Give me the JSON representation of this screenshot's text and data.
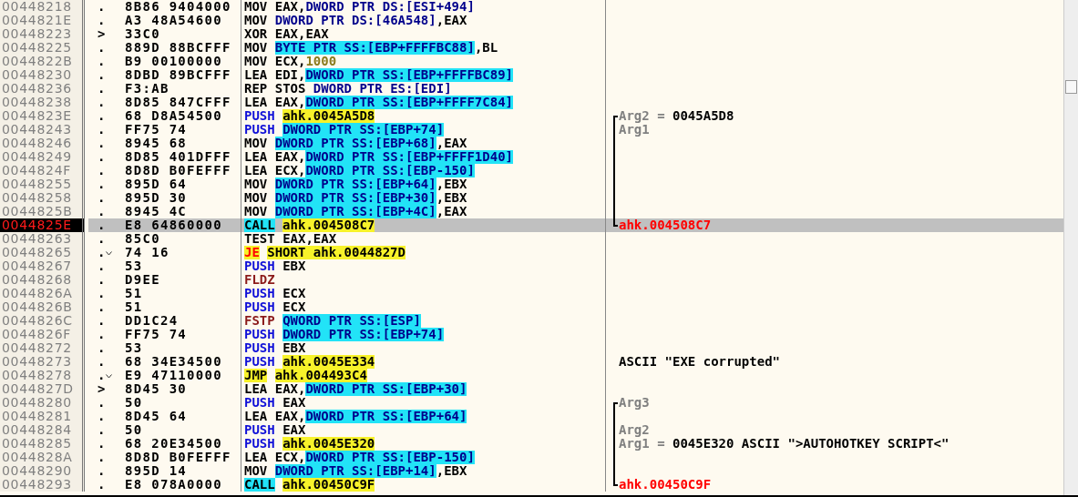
{
  "rows": [
    {
      "address": "00448218",
      "marker": ".",
      "jump": false,
      "selected": false,
      "hex": "8B86 9404000",
      "code": [
        {
          "kind": "plain",
          "text": "MOV EAX,"
        },
        {
          "kind": "ptr",
          "text": "DWORD PTR DS:[ESI+494]"
        }
      ]
    },
    {
      "address": "0044821E",
      "marker": ".",
      "jump": false,
      "selected": false,
      "hex": "A3 48A54600",
      "code": [
        {
          "kind": "plain",
          "text": "MOV "
        },
        {
          "kind": "ptr",
          "text": "DWORD PTR DS:[46A548]"
        },
        {
          "kind": "plain",
          "text": ",EAX"
        }
      ]
    },
    {
      "address": "00448223",
      "marker": ">",
      "jump": false,
      "selected": false,
      "hex": "33C0",
      "code": [
        {
          "kind": "plain",
          "text": "XOR EAX,EAX"
        }
      ]
    },
    {
      "address": "00448225",
      "marker": ".",
      "jump": false,
      "selected": false,
      "hex": "889D 88BCFFF",
      "code": [
        {
          "kind": "plain",
          "text": "MOV "
        },
        {
          "kind": "mem",
          "text": "BYTE PTR SS:[EBP+FFFFBC88]"
        },
        {
          "kind": "plain",
          "text": ",BL"
        }
      ]
    },
    {
      "address": "0044822B",
      "marker": ".",
      "jump": false,
      "selected": false,
      "hex": "B9 00100000",
      "code": [
        {
          "kind": "plain",
          "text": "MOV ECX,"
        },
        {
          "kind": "const",
          "text": "1000"
        }
      ]
    },
    {
      "address": "00448230",
      "marker": ".",
      "jump": false,
      "selected": false,
      "hex": "8DBD 89BCFFF",
      "code": [
        {
          "kind": "plain",
          "text": "LEA EDI,"
        },
        {
          "kind": "mem",
          "text": "DWORD PTR SS:[EBP+FFFFBC89]"
        }
      ]
    },
    {
      "address": "00448236",
      "marker": ".",
      "jump": false,
      "selected": false,
      "hex": "F3:AB",
      "code": [
        {
          "kind": "plain",
          "text": "REP STOS "
        },
        {
          "kind": "ptr",
          "text": "DWORD PTR ES:[EDI]"
        }
      ]
    },
    {
      "address": "00448238",
      "marker": ".",
      "jump": false,
      "selected": false,
      "hex": "8D85 847CFFF",
      "code": [
        {
          "kind": "plain",
          "text": "LEA EAX,"
        },
        {
          "kind": "mem",
          "text": "DWORD PTR SS:[EBP+FFFF7C84]"
        }
      ]
    },
    {
      "address": "0044823E",
      "marker": ".",
      "jump": false,
      "selected": false,
      "hex": "68 D8A54500",
      "code": [
        {
          "kind": "push",
          "text": "PUSH "
        },
        {
          "kind": "addr",
          "text": "ahk.0045A5D8"
        }
      ],
      "bracket": {
        "kind": "start"
      },
      "comment": [
        {
          "kind": "label",
          "text": "Arg2 = "
        },
        {
          "kind": "value",
          "text": "0045A5D8"
        }
      ]
    },
    {
      "address": "00448243",
      "marker": ".",
      "jump": false,
      "selected": false,
      "hex": "FF75 74",
      "code": [
        {
          "kind": "push",
          "text": "PUSH "
        },
        {
          "kind": "mem",
          "text": "DWORD PTR SS:[EBP+74]"
        }
      ],
      "bracket": {
        "kind": "line"
      },
      "comment": [
        {
          "kind": "label",
          "text": "Arg1"
        }
      ]
    },
    {
      "address": "00448246",
      "marker": ".",
      "jump": false,
      "selected": false,
      "hex": "8945 68",
      "code": [
        {
          "kind": "plain",
          "text": "MOV "
        },
        {
          "kind": "mem",
          "text": "DWORD PTR SS:[EBP+68]"
        },
        {
          "kind": "plain",
          "text": ",EAX"
        }
      ],
      "bracket": {
        "kind": "line"
      }
    },
    {
      "address": "00448249",
      "marker": ".",
      "jump": false,
      "selected": false,
      "hex": "8D85 401DFFF",
      "code": [
        {
          "kind": "plain",
          "text": "LEA EAX,"
        },
        {
          "kind": "mem",
          "text": "DWORD PTR SS:[EBP+FFFF1D40]"
        }
      ],
      "bracket": {
        "kind": "line"
      }
    },
    {
      "address": "0044824F",
      "marker": ".",
      "jump": false,
      "selected": false,
      "hex": "8D8D B0FEFFF",
      "code": [
        {
          "kind": "plain",
          "text": "LEA ECX,"
        },
        {
          "kind": "mem",
          "text": "DWORD PTR SS:[EBP-150]"
        }
      ],
      "bracket": {
        "kind": "line"
      }
    },
    {
      "address": "00448255",
      "marker": ".",
      "jump": false,
      "selected": false,
      "hex": "895D 64",
      "code": [
        {
          "kind": "plain",
          "text": "MOV "
        },
        {
          "kind": "mem",
          "text": "DWORD PTR SS:[EBP+64]"
        },
        {
          "kind": "plain",
          "text": ",EBX"
        }
      ],
      "bracket": {
        "kind": "line"
      }
    },
    {
      "address": "00448258",
      "marker": ".",
      "jump": false,
      "selected": false,
      "hex": "895D 30",
      "code": [
        {
          "kind": "plain",
          "text": "MOV "
        },
        {
          "kind": "mem",
          "text": "DWORD PTR SS:[EBP+30]"
        },
        {
          "kind": "plain",
          "text": ",EBX"
        }
      ],
      "bracket": {
        "kind": "line"
      }
    },
    {
      "address": "0044825B",
      "marker": ".",
      "jump": false,
      "selected": false,
      "hex": "8945 4C",
      "code": [
        {
          "kind": "plain",
          "text": "MOV "
        },
        {
          "kind": "mem",
          "text": "DWORD PTR SS:[EBP+4C]"
        },
        {
          "kind": "plain",
          "text": ",EAX"
        }
      ],
      "bracket": {
        "kind": "line"
      }
    },
    {
      "address": "0044825E",
      "marker": ".",
      "jump": false,
      "selected": true,
      "hex": "E8 64860000",
      "code": [
        {
          "kind": "call",
          "text": "CALL"
        },
        {
          "kind": "addr",
          "text": "ahk.004508C7"
        }
      ],
      "bracket": {
        "kind": "end"
      },
      "comment": [
        {
          "kind": "ref",
          "text": "ahk.004508C7"
        }
      ]
    },
    {
      "address": "00448263",
      "marker": ".",
      "jump": false,
      "selected": false,
      "hex": "85C0",
      "code": [
        {
          "kind": "plain",
          "text": "TEST EAX,EAX"
        }
      ]
    },
    {
      "address": "00448265",
      "marker": ".",
      "jump": true,
      "selected": false,
      "hex": "74 16",
      "code": [
        {
          "kind": "jcc",
          "text": "JE"
        },
        {
          "kind": "addr",
          "text": "SHORT ahk.0044827D"
        }
      ]
    },
    {
      "address": "00448267",
      "marker": ".",
      "jump": false,
      "selected": false,
      "hex": "53",
      "code": [
        {
          "kind": "push",
          "text": "PUSH "
        },
        {
          "kind": "plain",
          "text": "EBX"
        }
      ]
    },
    {
      "address": "00448268",
      "marker": ".",
      "jump": false,
      "selected": false,
      "hex": "D9EE",
      "code": [
        {
          "kind": "fpu",
          "text": "FLDZ"
        }
      ]
    },
    {
      "address": "0044826A",
      "marker": ".",
      "jump": false,
      "selected": false,
      "hex": "51",
      "code": [
        {
          "kind": "push",
          "text": "PUSH "
        },
        {
          "kind": "plain",
          "text": "ECX"
        }
      ]
    },
    {
      "address": "0044826B",
      "marker": ".",
      "jump": false,
      "selected": false,
      "hex": "51",
      "code": [
        {
          "kind": "push",
          "text": "PUSH "
        },
        {
          "kind": "plain",
          "text": "ECX"
        }
      ]
    },
    {
      "address": "0044826C",
      "marker": ".",
      "jump": false,
      "selected": false,
      "hex": "DD1C24",
      "code": [
        {
          "kind": "fpu",
          "text": "FSTP "
        },
        {
          "kind": "mem",
          "text": "QWORD PTR SS:[ESP]"
        }
      ]
    },
    {
      "address": "0044826F",
      "marker": ".",
      "jump": false,
      "selected": false,
      "hex": "FF75 74",
      "code": [
        {
          "kind": "push",
          "text": "PUSH "
        },
        {
          "kind": "mem",
          "text": "DWORD PTR SS:[EBP+74]"
        }
      ]
    },
    {
      "address": "00448272",
      "marker": ".",
      "jump": false,
      "selected": false,
      "hex": "53",
      "code": [
        {
          "kind": "push",
          "text": "PUSH "
        },
        {
          "kind": "plain",
          "text": "EBX"
        }
      ]
    },
    {
      "address": "00448273",
      "marker": ".",
      "jump": false,
      "selected": false,
      "hex": "68 34E34500",
      "code": [
        {
          "kind": "push",
          "text": "PUSH "
        },
        {
          "kind": "addr",
          "text": "ahk.0045E334"
        }
      ],
      "comment": [
        {
          "kind": "value",
          "text": "ASCII \"EXE corrupted\""
        }
      ]
    },
    {
      "address": "00448278",
      "marker": ".",
      "jump": true,
      "selected": false,
      "hex": "E9 47110000",
      "code": [
        {
          "kind": "jmp",
          "text": "JMP"
        },
        {
          "kind": "addr",
          "text": "ahk.004493C4"
        }
      ]
    },
    {
      "address": "0044827D",
      "marker": ">",
      "jump": false,
      "selected": false,
      "hex": "8D45 30",
      "code": [
        {
          "kind": "plain",
          "text": "LEA EAX,"
        },
        {
          "kind": "mem",
          "text": "DWORD PTR SS:[EBP+30]"
        }
      ]
    },
    {
      "address": "00448280",
      "marker": ".",
      "jump": false,
      "selected": false,
      "hex": "50",
      "code": [
        {
          "kind": "push",
          "text": "PUSH "
        },
        {
          "kind": "plain",
          "text": "EAX"
        }
      ],
      "bracket": {
        "kind": "start"
      },
      "comment": [
        {
          "kind": "label",
          "text": "Arg3"
        }
      ]
    },
    {
      "address": "00448281",
      "marker": ".",
      "jump": false,
      "selected": false,
      "hex": "8D45 64",
      "code": [
        {
          "kind": "plain",
          "text": "LEA EAX,"
        },
        {
          "kind": "mem",
          "text": "DWORD PTR SS:[EBP+64]"
        }
      ],
      "bracket": {
        "kind": "line"
      }
    },
    {
      "address": "00448284",
      "marker": ".",
      "jump": false,
      "selected": false,
      "hex": "50",
      "code": [
        {
          "kind": "push",
          "text": "PUSH "
        },
        {
          "kind": "plain",
          "text": "EAX"
        }
      ],
      "bracket": {
        "kind": "line"
      },
      "comment": [
        {
          "kind": "label",
          "text": "Arg2"
        }
      ]
    },
    {
      "address": "00448285",
      "marker": ".",
      "jump": false,
      "selected": false,
      "hex": "68 20E34500",
      "code": [
        {
          "kind": "push",
          "text": "PUSH "
        },
        {
          "kind": "addr",
          "text": "ahk.0045E320"
        }
      ],
      "bracket": {
        "kind": "line"
      },
      "comment": [
        {
          "kind": "label",
          "text": "Arg1 = "
        },
        {
          "kind": "value",
          "text": "0045E320 ASCII \">AUTOHOTKEY SCRIPT<\""
        }
      ]
    },
    {
      "address": "0044828A",
      "marker": ".",
      "jump": false,
      "selected": false,
      "hex": "8D8D B0FEFFF",
      "code": [
        {
          "kind": "plain",
          "text": "LEA ECX,"
        },
        {
          "kind": "mem",
          "text": "DWORD PTR SS:[EBP-150]"
        }
      ],
      "bracket": {
        "kind": "line"
      }
    },
    {
      "address": "00448290",
      "marker": ".",
      "jump": false,
      "selected": false,
      "hex": "895D 14",
      "code": [
        {
          "kind": "plain",
          "text": "MOV "
        },
        {
          "kind": "mem",
          "text": "DWORD PTR SS:[EBP+14]"
        },
        {
          "kind": "plain",
          "text": ",EBX"
        }
      ],
      "bracket": {
        "kind": "line"
      }
    },
    {
      "address": "00448293",
      "marker": ".",
      "jump": false,
      "selected": false,
      "hex": "E8 078A0000",
      "code": [
        {
          "kind": "call",
          "text": "CALL"
        },
        {
          "kind": "addr",
          "text": "ahk.00450C9F"
        }
      ],
      "bracket": {
        "kind": "end"
      },
      "comment": [
        {
          "kind": "ref",
          "text": "ahk.00450C9F"
        }
      ]
    }
  ]
}
